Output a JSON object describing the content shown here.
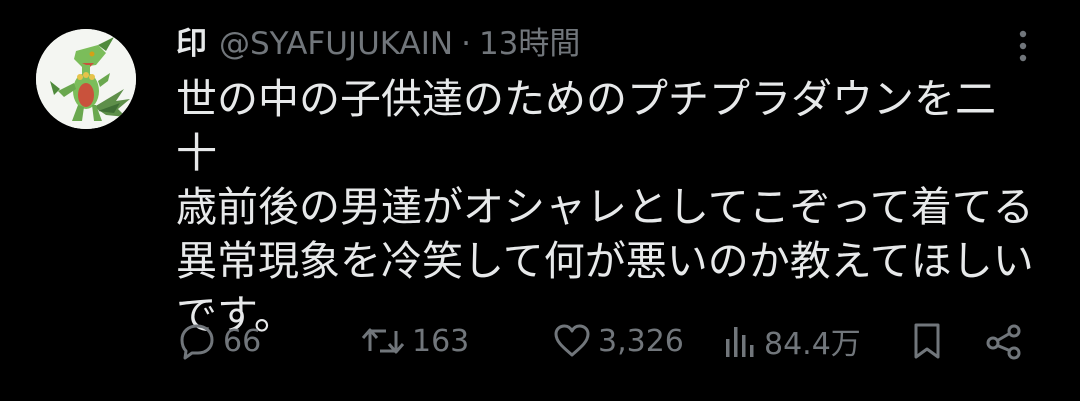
{
  "tweet": {
    "display_name": "印",
    "handle": "@SYAFUJUKAIN",
    "separator": "·",
    "time": "13時間",
    "text": "世の中の子供達のためのプチプラダウンを二十\n歳前後の男達がオシャレとしてこぞって着てる\n異常現象を冷笑して何が悪いのか教えてほしい\nです。",
    "avatar_icon": "green-lizard-creature-avatar"
  },
  "actions": {
    "replies": "66",
    "retweets": "163",
    "likes": "3,326",
    "views": "84.4万",
    "reply_icon": "speech-bubble-icon",
    "retweet_icon": "retweet-arrows-icon",
    "like_icon": "heart-icon",
    "views_icon": "bar-chart-icon",
    "bookmark_icon": "bookmark-icon",
    "share_icon": "share-icon"
  },
  "colors": {
    "background": "#000000",
    "text_primary": "#e7e9ea",
    "text_secondary": "#71767b"
  }
}
